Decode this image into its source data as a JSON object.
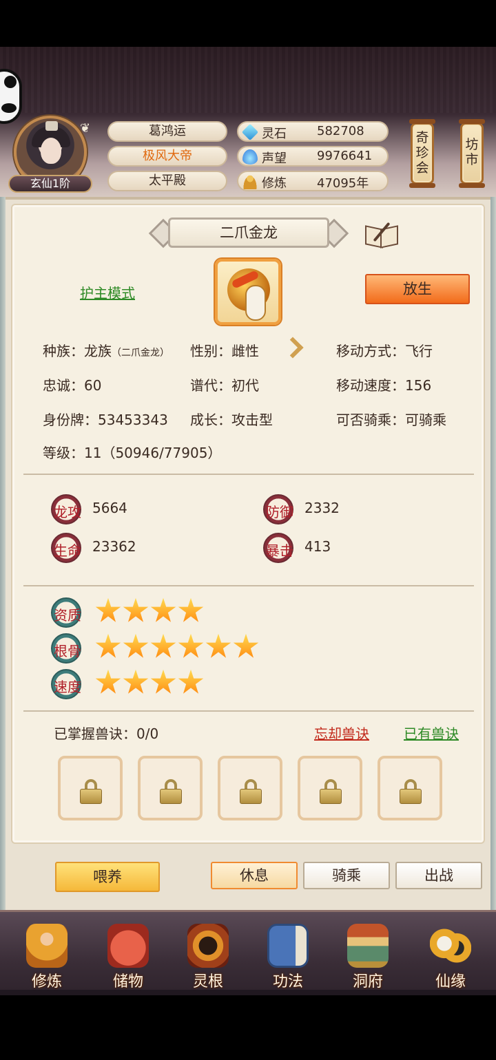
{
  "player": {
    "rank": "玄仙1阶",
    "name": "葛鸿运",
    "title": "极风大帝",
    "sect": "太平殿"
  },
  "resources": [
    {
      "label": "灵石",
      "value": "582708",
      "icon": "spirit-stone-icon"
    },
    {
      "label": "声望",
      "value": "9976641",
      "icon": "reputation-icon"
    },
    {
      "label": "修炼",
      "value": "47095年",
      "icon": "cultivation-icon"
    }
  ],
  "lanterns": [
    {
      "label": "奇\n珍\n会"
    },
    {
      "label": "坊\n市"
    }
  ],
  "pet": {
    "name": "二爪金龙",
    "mode_link": "护主模式",
    "release_button": "放生",
    "info": {
      "race": "种族：龙族",
      "race_sub": "（二爪金龙）",
      "gender": "性别：雌性",
      "move_type": "移动方式：飞行",
      "loyalty": "忠诚：60",
      "generation": "谱代：初代",
      "move_speed": "移动速度：156",
      "id_tag": "身份牌：53453343",
      "growth": "成长：攻击型",
      "rideable": "可否骑乘：可骑乘",
      "level": "等级：11（50946/77905）"
    },
    "stats": [
      {
        "label": "龙攻",
        "value": "5664"
      },
      {
        "label": "防御",
        "value": "2332"
      },
      {
        "label": "生命",
        "value": "23362"
      },
      {
        "label": "暴击",
        "value": "413"
      }
    ],
    "talents": [
      {
        "label": "资质",
        "stars": 4
      },
      {
        "label": "根骨",
        "stars": 6
      },
      {
        "label": "速度",
        "stars": 4
      }
    ],
    "skills": {
      "mastered": "已掌握兽诀：0/0",
      "forget_link": "忘却兽诀",
      "owned_link": "已有兽诀"
    }
  },
  "actions": {
    "feed": "喂养",
    "rest": "休息",
    "ride": "骑乘",
    "battle": "出战"
  },
  "nav": [
    {
      "label": "修炼",
      "icon": "cultivate-icon"
    },
    {
      "label": "储物",
      "icon": "storage-bag-icon"
    },
    {
      "label": "灵根",
      "icon": "spirit-root-icon"
    },
    {
      "label": "功法",
      "icon": "technique-book-icon"
    },
    {
      "label": "洞府",
      "icon": "cave-mansion-icon"
    },
    {
      "label": "仙缘",
      "icon": "immortal-fate-icon"
    }
  ]
}
